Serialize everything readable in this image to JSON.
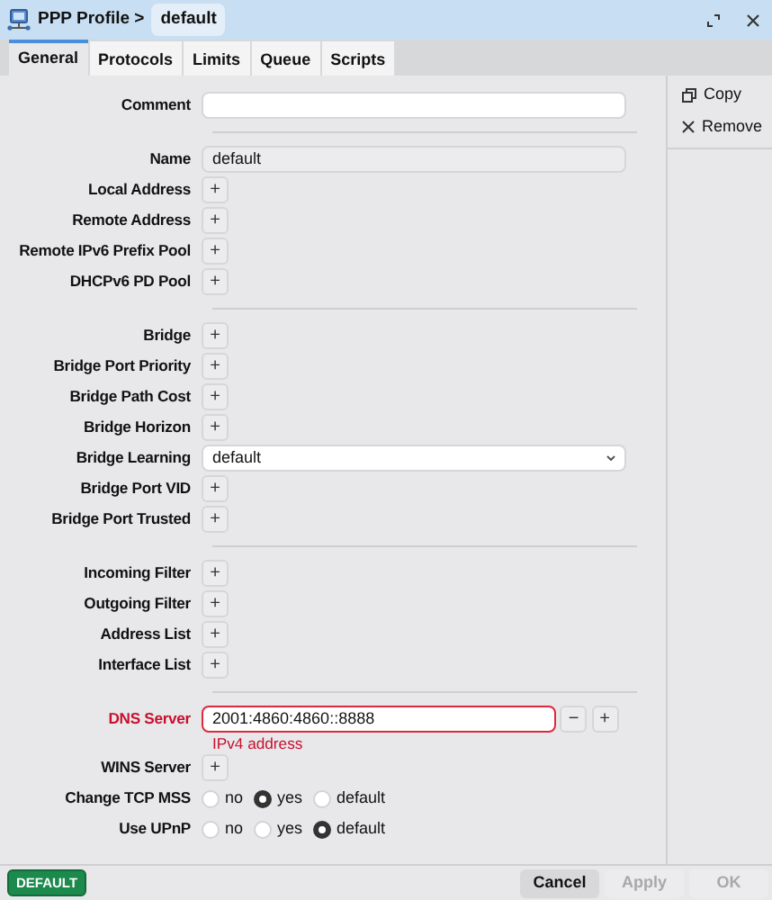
{
  "window": {
    "breadcrumb": "PPP Profile >",
    "title": "default"
  },
  "tabs": [
    {
      "label": "General",
      "selected": true
    },
    {
      "label": "Protocols",
      "selected": false
    },
    {
      "label": "Limits",
      "selected": false
    },
    {
      "label": "Queue",
      "selected": false
    },
    {
      "label": "Scripts",
      "selected": false
    }
  ],
  "side_actions": [
    {
      "kind": "copy",
      "label": "Copy"
    },
    {
      "kind": "remove",
      "label": "Remove"
    }
  ],
  "sections": [
    {
      "fields": [
        {
          "kind": "text",
          "label": "Comment",
          "disabled": false
        }
      ]
    },
    {
      "fields": [
        {
          "kind": "text",
          "label": "Name",
          "value": "default",
          "disabled": true
        },
        {
          "kind": "add",
          "label": "Local Address",
          "button": "+"
        },
        {
          "kind": "add",
          "label": "Remote Address",
          "button": "+"
        },
        {
          "kind": "add",
          "label": "Remote IPv6 Prefix Pool",
          "button": "+"
        },
        {
          "kind": "add",
          "label": "DHCPv6 PD Pool",
          "button": "+"
        }
      ]
    },
    {
      "fields": [
        {
          "kind": "add",
          "label": "Bridge",
          "button": "+"
        },
        {
          "kind": "add",
          "label": "Bridge Port Priority",
          "button": "+"
        },
        {
          "kind": "add",
          "label": "Bridge Path Cost",
          "button": "+"
        },
        {
          "kind": "add",
          "label": "Bridge Horizon",
          "button": "+"
        },
        {
          "kind": "select",
          "label": "Bridge Learning",
          "value": "default"
        },
        {
          "kind": "add",
          "label": "Bridge Port VID",
          "button": "+"
        },
        {
          "kind": "add",
          "label": "Bridge Port Trusted",
          "button": "+"
        }
      ]
    },
    {
      "fields": [
        {
          "kind": "add",
          "label": "Incoming Filter",
          "button": "+"
        },
        {
          "kind": "add",
          "label": "Outgoing Filter",
          "button": "+"
        },
        {
          "kind": "add",
          "label": "Address List",
          "button": "+"
        },
        {
          "kind": "add",
          "label": "Interface List",
          "button": "+"
        }
      ]
    },
    {
      "fields": [
        {
          "kind": "list",
          "label": "DNS Server",
          "value": "2001:4860:4860::8888",
          "error": true,
          "hint": "IPv4 address",
          "buttons": [
            "−",
            "+"
          ]
        },
        {
          "kind": "add",
          "label": "WINS Server",
          "button": "+"
        },
        {
          "kind": "radio",
          "label": "Change TCP MSS",
          "options": [
            {
              "label": "no",
              "selected": false
            },
            {
              "label": "yes",
              "selected": true
            },
            {
              "label": "default",
              "selected": false
            }
          ]
        },
        {
          "kind": "radio",
          "label": "Use UPnP",
          "options": [
            {
              "label": "no",
              "selected": false
            },
            {
              "label": "yes",
              "selected": false
            },
            {
              "label": "default",
              "selected": true
            }
          ]
        }
      ]
    }
  ],
  "footer": {
    "badge": "DEFAULT",
    "buttons": [
      {
        "label": "Cancel",
        "disabled": false
      },
      {
        "label": "Apply",
        "disabled": true
      },
      {
        "label": "OK",
        "disabled": true
      }
    ]
  }
}
